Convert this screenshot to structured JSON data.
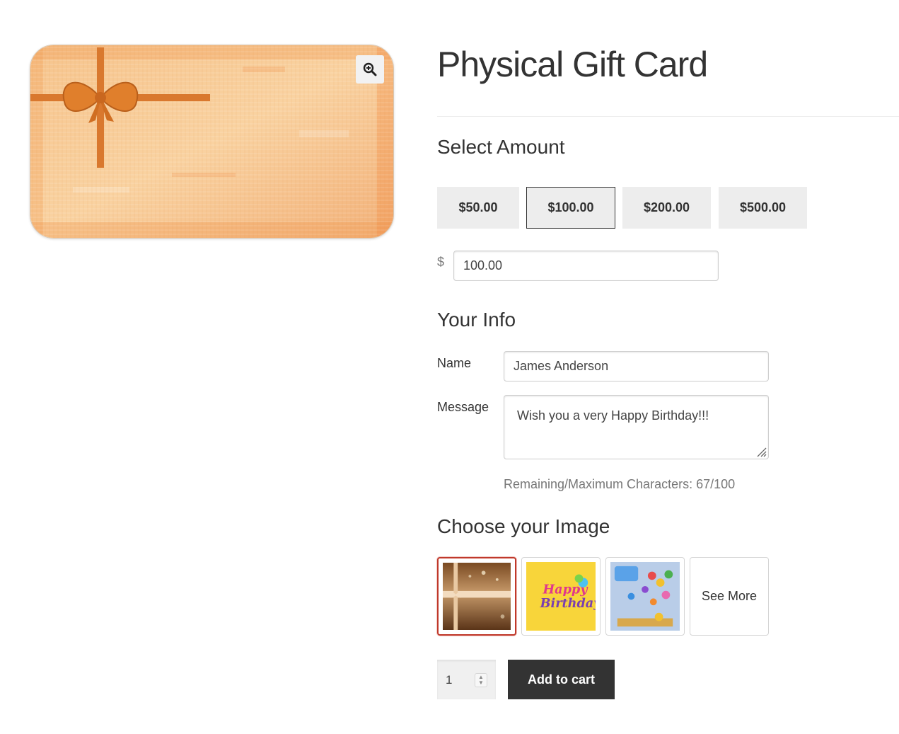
{
  "product": {
    "title": "Physical Gift Card"
  },
  "amount": {
    "heading": "Select Amount",
    "options": [
      "$50.00",
      "$100.00",
      "$200.00",
      "$500.00"
    ],
    "selected_index": 1,
    "currency_symbol": "$",
    "custom_value": "100.00"
  },
  "info": {
    "heading": "Your Info",
    "name_label": "Name",
    "name_value": "James Anderson",
    "message_label": "Message",
    "message_value": "Wish you a very Happy Birthday!!!",
    "char_count": "Remaining/Maximum Characters: 67/100"
  },
  "images": {
    "heading": "Choose your Image",
    "selected_index": 0,
    "see_more_label": "See More",
    "thumb_texts": [
      "Happy",
      "Birthday"
    ]
  },
  "cart": {
    "quantity": "1",
    "add_label": "Add to cart"
  },
  "colors": {
    "accent_dark": "#333333",
    "selected_thumb_border": "#c0392b"
  },
  "icons": {
    "zoom": "zoom-in-icon",
    "resize": "resize-grip-icon"
  }
}
